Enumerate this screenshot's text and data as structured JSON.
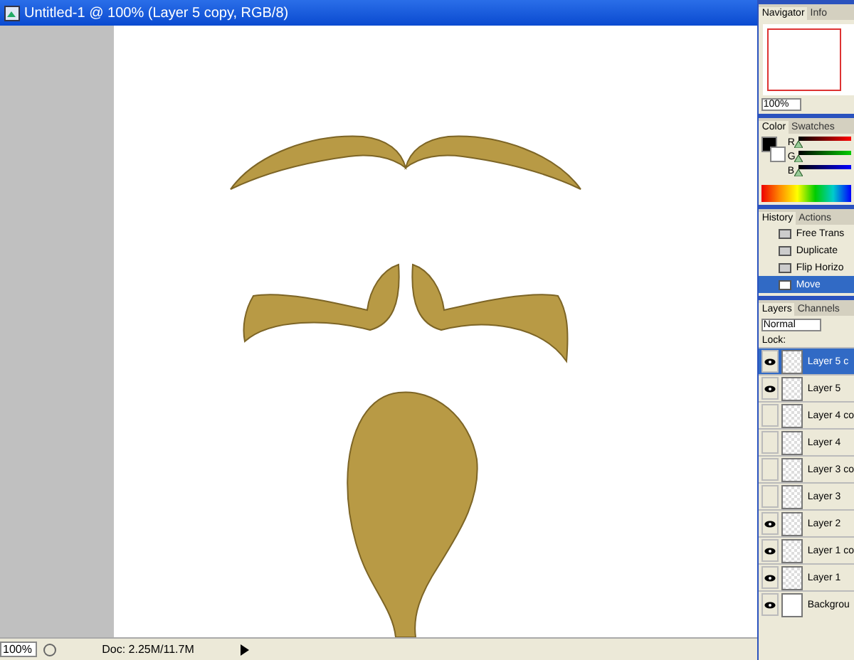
{
  "window": {
    "title": "Untitled-1 @ 100% (Layer 5 copy, RGB/8)"
  },
  "status_bar": {
    "zoom": "100%",
    "doc": "Doc: 2.25M/11.7M"
  },
  "navigator": {
    "tabs": [
      {
        "label": "Navigator",
        "selected": true
      },
      {
        "label": "Info",
        "selected": false
      }
    ],
    "zoom": "100%"
  },
  "color": {
    "tabs": [
      {
        "label": "Color",
        "selected": true
      },
      {
        "label": "Swatches",
        "selected": false
      }
    ],
    "channels": [
      {
        "name": "R",
        "level": 0
      },
      {
        "name": "G",
        "level": 0
      },
      {
        "name": "B",
        "level": 0
      }
    ]
  },
  "history": {
    "tabs": [
      {
        "label": "History",
        "selected": true
      },
      {
        "label": "Actions",
        "selected": false
      }
    ],
    "items": [
      {
        "label": "Free Trans",
        "selected": false
      },
      {
        "label": "Duplicate",
        "selected": false
      },
      {
        "label": "Flip Horizo",
        "selected": false
      },
      {
        "label": "Move",
        "selected": true
      }
    ]
  },
  "layers": {
    "tabs": [
      {
        "label": "Layers",
        "selected": true
      },
      {
        "label": "Channels",
        "selected": false
      }
    ],
    "blend_mode": "Normal",
    "lock_label": "Lock:",
    "items": [
      {
        "name": "Layer 5 c",
        "visible": true,
        "selected": true
      },
      {
        "name": "Layer 5",
        "visible": true,
        "selected": false
      },
      {
        "name": "Layer 4 co",
        "visible": false,
        "selected": false
      },
      {
        "name": "Layer 4",
        "visible": false,
        "selected": false
      },
      {
        "name": "Layer 3 co",
        "visible": false,
        "selected": false
      },
      {
        "name": "Layer 3",
        "visible": false,
        "selected": false
      },
      {
        "name": "Layer 2",
        "visible": true,
        "selected": false
      },
      {
        "name": "Layer 1 co",
        "visible": true,
        "selected": false
      },
      {
        "name": "Layer 1",
        "visible": true,
        "selected": false
      },
      {
        "name": "Backgrou",
        "visible": true,
        "selected": false
      }
    ]
  }
}
